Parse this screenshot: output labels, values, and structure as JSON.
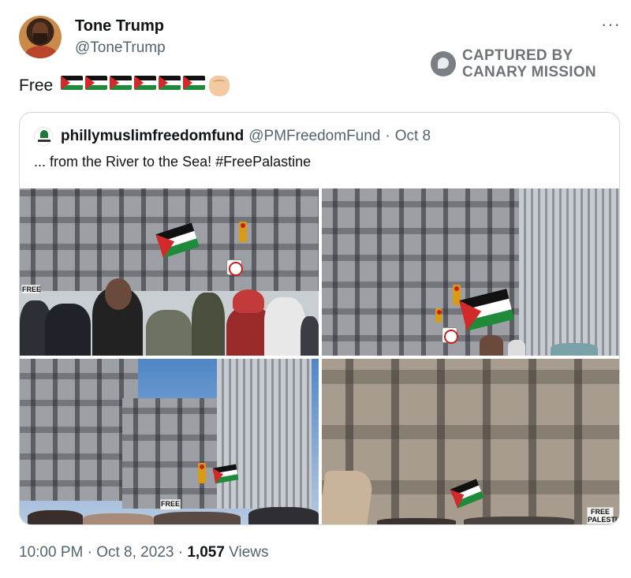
{
  "author": {
    "display_name": "Tone Trump",
    "handle": "@ToneTrump"
  },
  "menu": {
    "more_label": "···"
  },
  "watermark": {
    "line1": "CAPTURED BY",
    "line2": "CANARY MISSION"
  },
  "tweet": {
    "text": "Free",
    "emoji": [
      "palestine-flag",
      "palestine-flag",
      "palestine-flag",
      "palestine-flag",
      "palestine-flag",
      "palestine-flag",
      "raised-fist-light-skin"
    ]
  },
  "quoted_tweet": {
    "account_name": "phillymuslimfreedomfund",
    "handle": "@PMFreedomFund",
    "separator": "·",
    "date": "Oct 8",
    "text": "... from the River to the Sea! #FreePalastine",
    "photos": [
      {
        "sign_text": "FREE"
      },
      {
        "sign_text": ""
      },
      {
        "sign_text": "FREE"
      },
      {
        "sign_text": "FREE PALESTINE"
      }
    ]
  },
  "footer": {
    "time": "10:00 PM",
    "separator": "·",
    "date": "Oct 8, 2023",
    "views_count": "1,057",
    "views_label": "Views"
  },
  "colors": {
    "text_primary": "#0f1419",
    "text_secondary": "#536471",
    "border": "#cfd9de",
    "flag_red": "#d22a2a",
    "flag_green": "#1e8a3a"
  }
}
